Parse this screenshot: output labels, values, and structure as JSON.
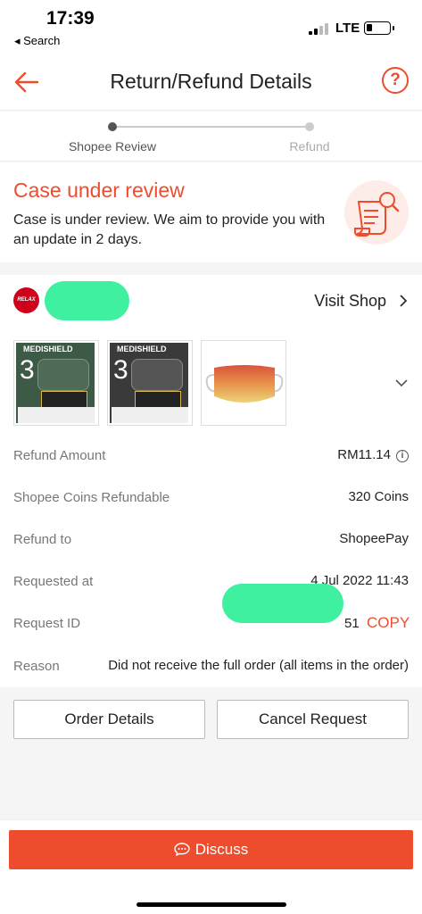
{
  "status_bar": {
    "time": "17:39",
    "back_app": "◂ Search",
    "network": "LTE"
  },
  "header": {
    "title": "Return/Refund Details",
    "back_icon": "arrow-left-icon",
    "help_icon": "question-circle-icon",
    "help_glyph": "?"
  },
  "progress": {
    "steps": [
      {
        "label": "Shopee Review",
        "active": true
      },
      {
        "label": "Refund",
        "active": false
      }
    ],
    "active_color": "#555555",
    "inactive_color": "#cccccc"
  },
  "case": {
    "title": "Case under review",
    "description": "Case is under review. We aim to provide you with an update in 2 days.",
    "icon": "document-search-icon"
  },
  "shop": {
    "logo_text": "RELAX",
    "visit_label": "Visit Shop",
    "chevron_icon": "chevron-right-icon"
  },
  "products": {
    "items": [
      {
        "brand": "MEDISHIELD",
        "count": "3",
        "color": "#3d5a47"
      },
      {
        "brand": "MEDISHIELD",
        "count": "3",
        "color": "#3a3a3a"
      },
      {
        "brand": "",
        "count": "",
        "color": "#e2813f"
      }
    ],
    "expand_icon": "chevron-down-icon"
  },
  "details": {
    "refund_amount": {
      "label": "Refund Amount",
      "value": "RM11.14",
      "icon": "info-icon",
      "glyph": "i"
    },
    "coins": {
      "label": "Shopee Coins Refundable",
      "value": "320 Coins"
    },
    "refund_to": {
      "label": "Refund to",
      "value": "ShopeePay"
    },
    "requested_at": {
      "label": "Requested at",
      "value": "4 Jul 2022 11:43"
    },
    "request_id": {
      "label": "Request ID",
      "visible_suffix": "51",
      "copy_label": "COPY"
    },
    "reason": {
      "label": "Reason",
      "value": "Did not receive the full order (all items in the order)"
    }
  },
  "actions": {
    "order_details": "Order Details",
    "cancel_request": "Cancel Request"
  },
  "footer": {
    "discuss_label": "Discuss",
    "discuss_icon": "chat-bubble-icon"
  },
  "colors": {
    "accent": "#ee4d2d",
    "redaction": "#3ff0a1"
  }
}
